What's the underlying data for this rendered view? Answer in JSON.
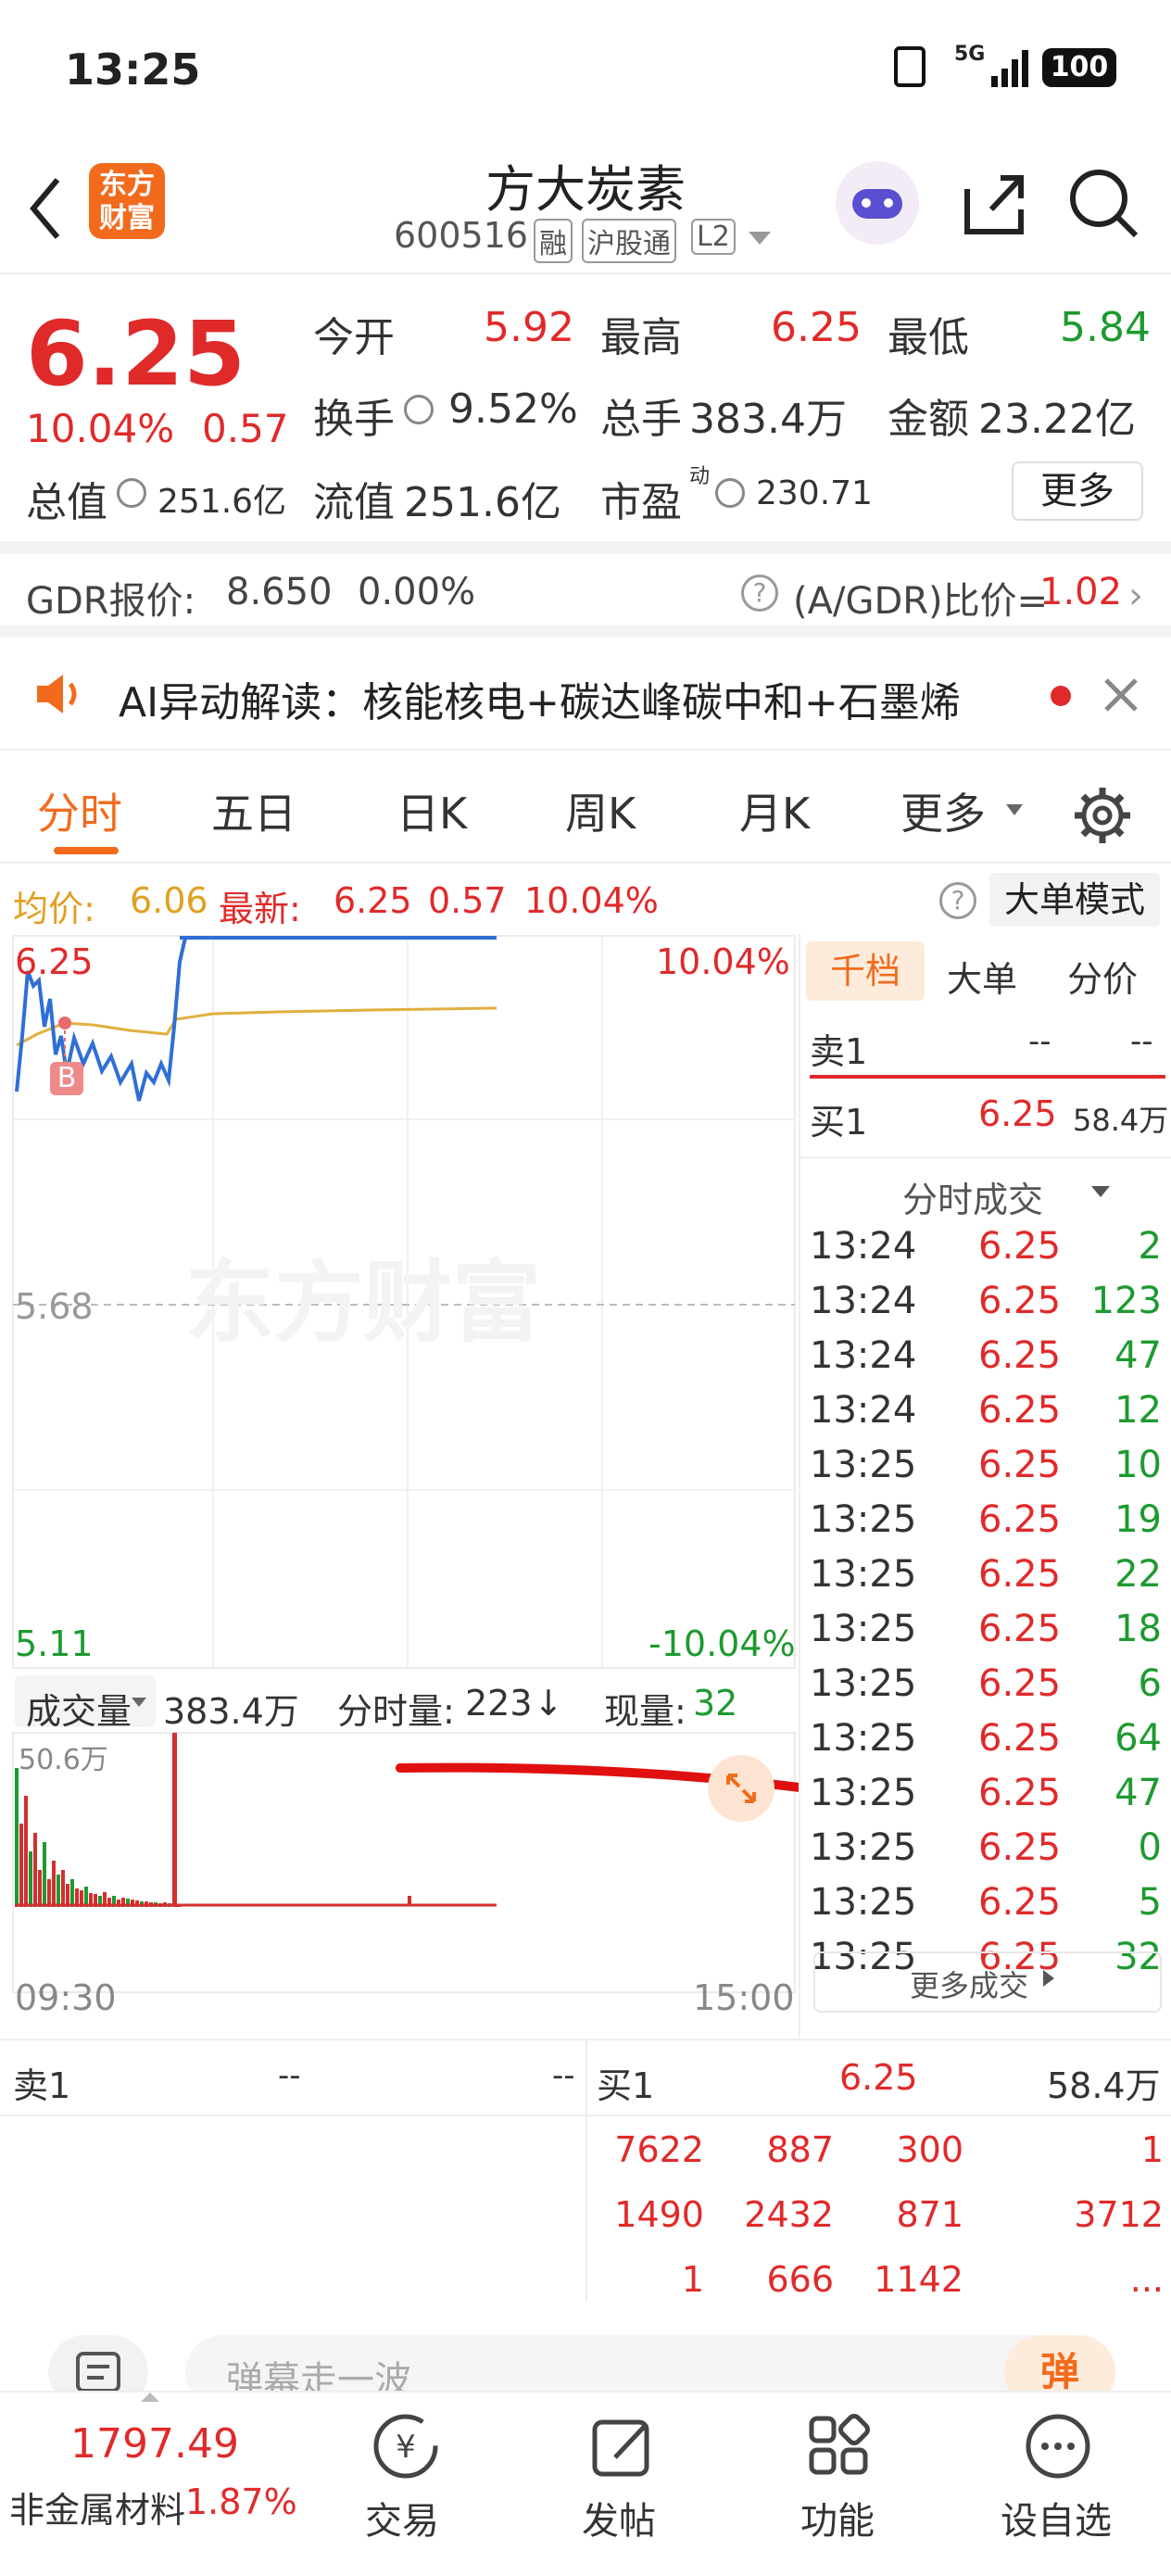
{
  "status": {
    "time": "13:25",
    "network": "5G",
    "battery": "100"
  },
  "header": {
    "logo": "东方财富",
    "name": "方大炭素",
    "code": "600516",
    "badges": [
      "融",
      "沪股通",
      "L2"
    ]
  },
  "quote": {
    "price": "6.25",
    "pct": "10.04%",
    "change": "0.57",
    "open_label": "今开",
    "open": "5.92",
    "high_label": "最高",
    "high": "6.25",
    "low_label": "最低",
    "low": "5.84",
    "turnover_label": "换手",
    "turnover": "9.52%",
    "volume_label": "总手",
    "volume": "383.4万",
    "amount_label": "金额",
    "amount": "23.22亿",
    "mcap_label": "总值",
    "mcap": "251.6亿",
    "float_label": "流值",
    "float": "251.6亿",
    "pe_label": "市盈",
    "pe_sup": "动",
    "pe": "230.71",
    "more": "更多"
  },
  "gdr": {
    "label": "GDR报价:",
    "price": "8.650",
    "pct": "0.00%",
    "ratio_label": "(A/GDR)比价=",
    "ratio": "1.02"
  },
  "ai": {
    "text": "AI异动解读：核能核电+碳达峰碳中和+石墨烯"
  },
  "tabs": [
    "分时",
    "五日",
    "日K",
    "周K",
    "月K",
    "更多"
  ],
  "avgline": {
    "avg_label": "均价:",
    "avg": "6.06",
    "latest_label": "最新:",
    "latest": "6.25",
    "chg": "0.57",
    "pct": "10.04%",
    "mode": "大单模式"
  },
  "chart": {
    "y_top": "6.25",
    "y_top_pct": "10.04%",
    "y_mid": "5.68",
    "y_bot": "5.11",
    "y_bot_pct": "-10.04%",
    "vol_label": "成交量",
    "vol_total": "383.4万",
    "tick_vol_label": "分时量:",
    "tick_vol": "223",
    "cur_vol_label": "现量:",
    "cur_vol": "32",
    "vol_max": "50.6万",
    "time_start": "09:30",
    "time_end": "15:00",
    "watermark": "东方财富",
    "marker": "B"
  },
  "panel": {
    "tabs": [
      "千档",
      "大单",
      "分价"
    ],
    "sell1_label": "卖1",
    "sell1_price": "--",
    "sell1_vol": "--",
    "buy1_label": "买1",
    "buy1_price": "6.25",
    "buy1_vol": "58.4万",
    "trades_header": "分时成交",
    "trades": [
      {
        "time": "13:24",
        "price": "6.25",
        "vol": "2"
      },
      {
        "time": "13:24",
        "price": "6.25",
        "vol": "123"
      },
      {
        "time": "13:24",
        "price": "6.25",
        "vol": "47"
      },
      {
        "time": "13:24",
        "price": "6.25",
        "vol": "12"
      },
      {
        "time": "13:25",
        "price": "6.25",
        "vol": "10"
      },
      {
        "time": "13:25",
        "price": "6.25",
        "vol": "19"
      },
      {
        "time": "13:25",
        "price": "6.25",
        "vol": "22"
      },
      {
        "time": "13:25",
        "price": "6.25",
        "vol": "18"
      },
      {
        "time": "13:25",
        "price": "6.25",
        "vol": "6"
      },
      {
        "time": "13:25",
        "price": "6.25",
        "vol": "64"
      },
      {
        "time": "13:25",
        "price": "6.25",
        "vol": "47"
      },
      {
        "time": "13:25",
        "price": "6.25",
        "vol": "0"
      },
      {
        "time": "13:25",
        "price": "6.25",
        "vol": "5"
      },
      {
        "time": "13:25",
        "price": "6.25",
        "vol": "32"
      }
    ],
    "more_trades": "更多成交"
  },
  "book": {
    "sell1_label": "卖1",
    "sell1_price": "--",
    "sell1_vol": "--",
    "buy1_label": "买1",
    "buy1_price": "6.25",
    "buy1_vol": "58.4万",
    "queue": [
      [
        "7622",
        "887",
        "300",
        "1"
      ],
      [
        "1490",
        "2432",
        "871",
        "3712"
      ],
      [
        "1",
        "666",
        "1142",
        "..."
      ]
    ]
  },
  "danmu": {
    "placeholder": "弹幕走一波",
    "btn": "弹"
  },
  "nav": {
    "index_value": "1797.49",
    "index_name": "非金属材料",
    "index_pct": "1.87%",
    "items": [
      "交易",
      "发帖",
      "功能",
      "设自选"
    ]
  }
}
